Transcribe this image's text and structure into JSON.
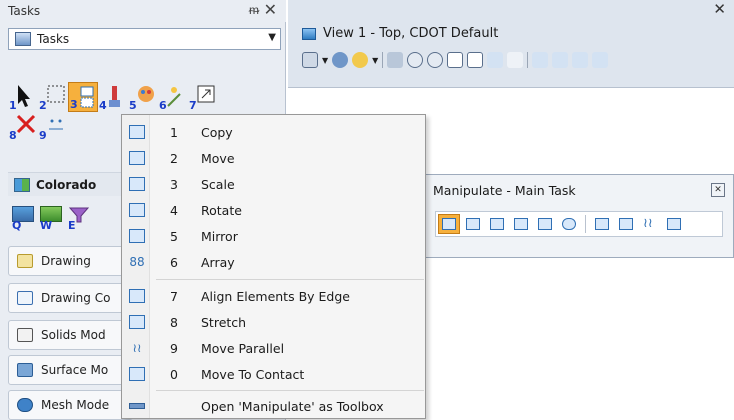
{
  "tasks_panel": {
    "title": "Tasks",
    "pin_glyph": "&#x1D7D;",
    "close_glyph": "✕",
    "dropdown_value": "Tasks",
    "tool_numbers": [
      "1",
      "2",
      "3",
      "4",
      "5",
      "6",
      "7",
      "8",
      "9"
    ],
    "section_header": "Colorado",
    "quick_letters": [
      "Q",
      "W",
      "E"
    ],
    "categories": [
      "Drawing",
      "Drawing Co",
      "Solids Mod",
      "Surface Mo",
      "Mesh Mode"
    ]
  },
  "view": {
    "title": "View 1 - Top, CDOT Default",
    "close_glyph": "✕"
  },
  "toolbox": {
    "title": "Manipulate - Main Task",
    "close_glyph": "✕"
  },
  "menu": {
    "items": [
      {
        "key": "1",
        "label": "Copy",
        "icon": "copy-icon"
      },
      {
        "key": "2",
        "label": "Move",
        "icon": "move-icon"
      },
      {
        "key": "3",
        "label": "Scale",
        "icon": "scale-icon"
      },
      {
        "key": "4",
        "label": "Rotate",
        "icon": "rotate-icon"
      },
      {
        "key": "5",
        "label": "Mirror",
        "icon": "mirror-icon"
      },
      {
        "key": "6",
        "label": "Array",
        "icon": "array-icon"
      },
      {
        "key": "7",
        "label": "Align Elements By Edge",
        "icon": "align-edge-icon"
      },
      {
        "key": "8",
        "label": "Stretch",
        "icon": "stretch-icon"
      },
      {
        "key": "9",
        "label": "Move Parallel",
        "icon": "move-parallel-icon"
      },
      {
        "key": "0",
        "label": "Move To Contact",
        "icon": "move-to-contact-icon"
      }
    ],
    "open_as_toolbox": "Open 'Manipulate' as Toolbox"
  },
  "colors": {
    "accent_active": "#f6b03d",
    "panel_bg": "#e9edf3",
    "menu_bg": "#f5f5f5"
  }
}
